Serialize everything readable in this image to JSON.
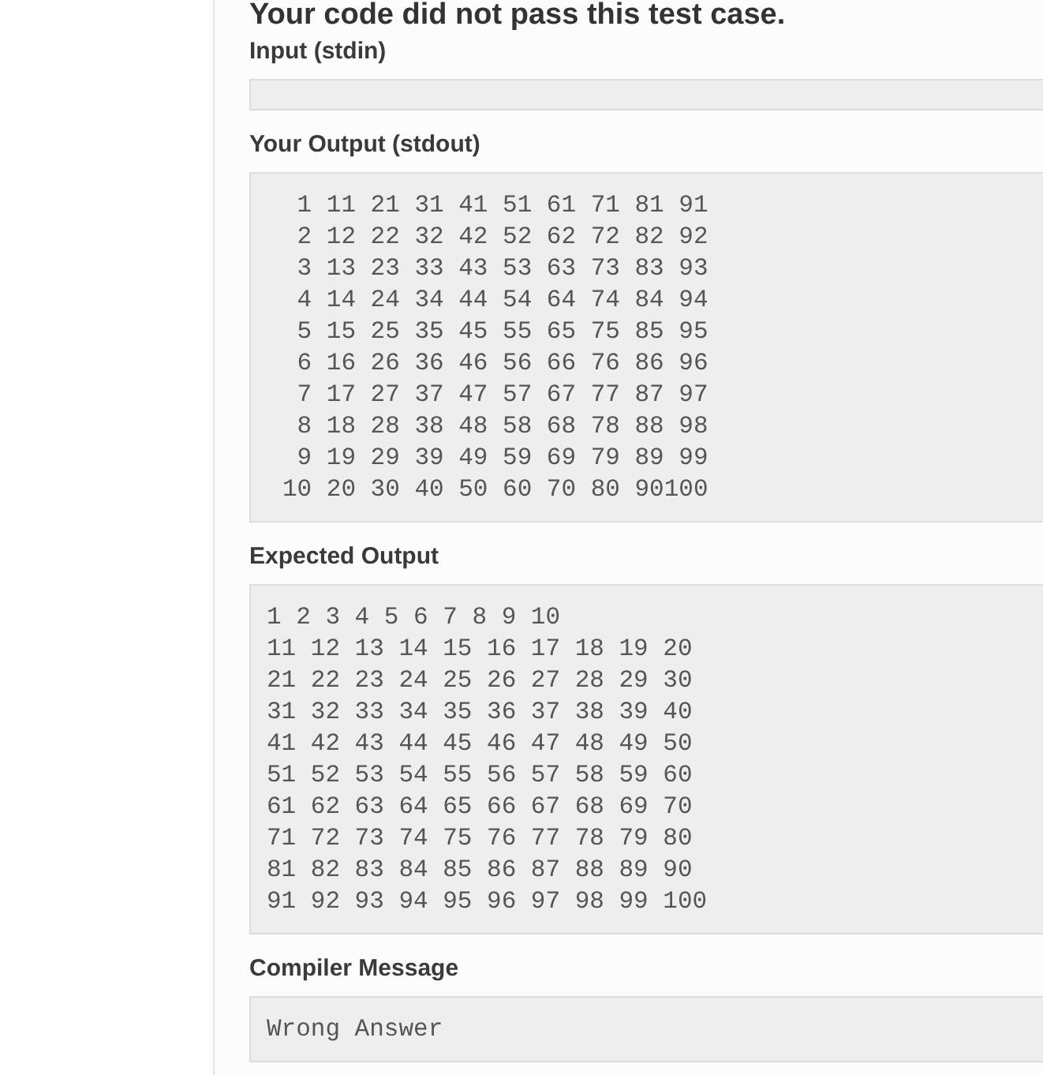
{
  "heading": "Your code did not pass this test case.",
  "sections": [
    {
      "label": "Input (stdin)"
    },
    {
      "label": "Your Output (stdout)",
      "lines": [
        " 1 11 21 31 41 51 61 71 81 91",
        " 2 12 22 32 42 52 62 72 82 92",
        " 3 13 23 33 43 53 63 73 83 93",
        " 4 14 24 34 44 54 64 74 84 94",
        " 5 15 25 35 45 55 65 75 85 95",
        " 6 16 26 36 46 56 66 76 86 96",
        " 7 17 27 37 47 57 67 77 87 97",
        " 8 18 28 38 48 58 68 78 88 98",
        " 9 19 29 39 49 59 69 79 89 99",
        "10 20 30 40 50 60 70 80 90100"
      ]
    },
    {
      "label": "Expected Output",
      "lines": [
        "1 2 3 4 5 6 7 8 9 10",
        "11 12 13 14 15 16 17 18 19 20",
        "21 22 23 24 25 26 27 28 29 30",
        "31 32 33 34 35 36 37 38 39 40",
        "41 42 43 44 45 46 47 48 49 50",
        "51 52 53 54 55 56 57 58 59 60",
        "61 62 63 64 65 66 67 68 69 70",
        "71 72 73 74 75 76 77 78 79 80",
        "81 82 83 84 85 86 87 88 89 90",
        "91 92 93 94 95 96 97 98 99 100"
      ]
    },
    {
      "label": "Compiler Message",
      "lines": [
        "Wrong Answer"
      ]
    }
  ]
}
